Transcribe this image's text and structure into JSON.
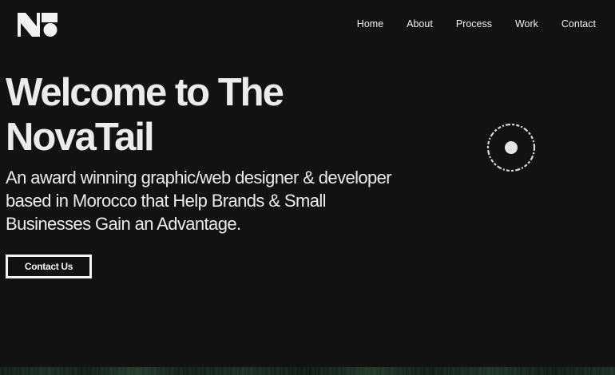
{
  "header": {
    "logo_alt": "NT",
    "nav": [
      {
        "label": "Home"
      },
      {
        "label": "About"
      },
      {
        "label": "Process"
      },
      {
        "label": "Work"
      },
      {
        "label": "Contact"
      }
    ]
  },
  "hero": {
    "title_line1": "Welcome to The",
    "title_line2": "NovaTail",
    "desc_line1": "An award winning graphic/web designer & developer",
    "desc_line2": "based in Morocco that Help Brands & Small",
    "desc_line3": "Businesses Gain an Advantage.",
    "cta_label": "Contact Us"
  },
  "colors": {
    "background": "#121212",
    "text": "#ececec",
    "accent": "#f4f4f4"
  },
  "icons": {
    "logo": "nt-logo-icon",
    "circle": "scroll-badge-icon"
  }
}
